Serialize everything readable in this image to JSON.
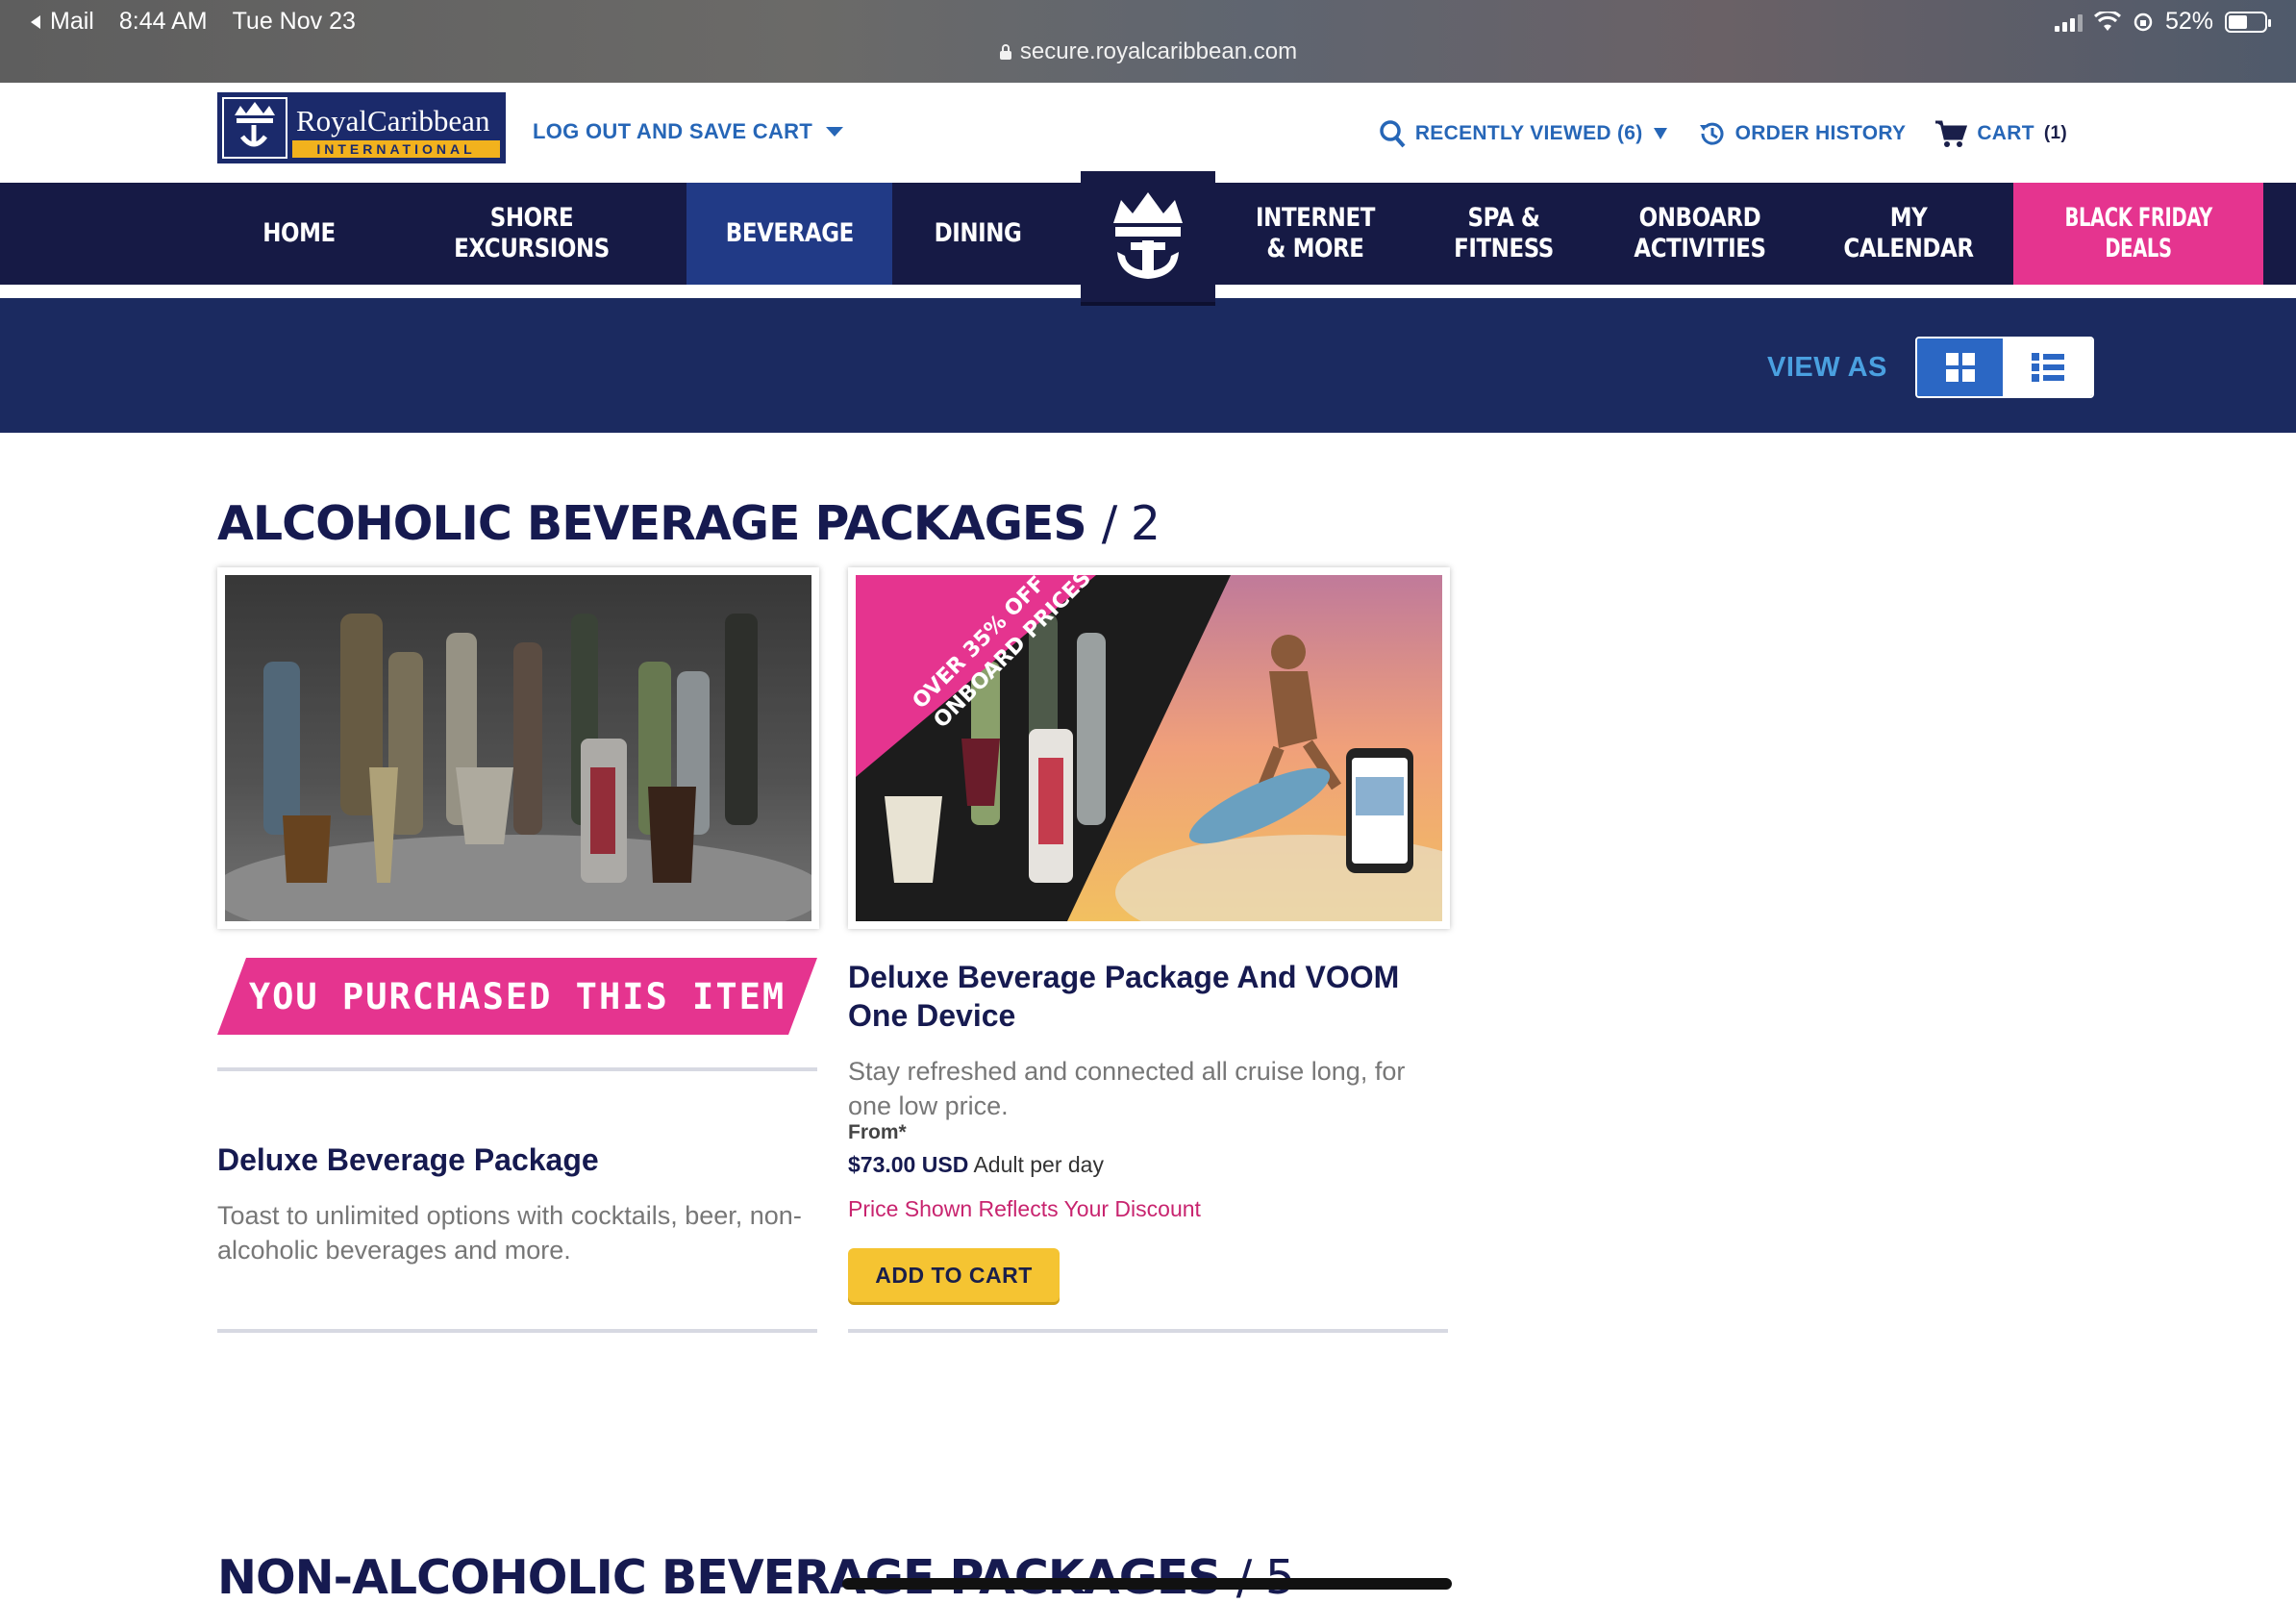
{
  "status_bar": {
    "back_app": "Mail",
    "time": "8:44 AM",
    "date": "Tue Nov 23",
    "battery": "52%",
    "battery_level": 0.52,
    "url": "secure.royalcaribbean.com"
  },
  "header": {
    "logo_text": "RoyalCaribbean",
    "logo_sub": "INTERNATIONAL",
    "logout_label": "LOG OUT AND SAVE CART",
    "recently_viewed": "RECENTLY VIEWED (6)",
    "order_history": "ORDER HISTORY",
    "cart_label": "CART",
    "cart_count": "(1)"
  },
  "nav": {
    "home": "HOME",
    "shore_excursions": "SHORE EXCURSIONS",
    "beverage": "BEVERAGE",
    "dining": "DINING",
    "internet_1": "INTERNET",
    "internet_2": "& MORE",
    "spa_1": "SPA &",
    "spa_2": "FITNESS",
    "onboard_1": "ONBOARD",
    "onboard_2": "ACTIVITIES",
    "calendar_1": "MY",
    "calendar_2": "CALENDAR",
    "black_friday_1": "BLACK FRIDAY",
    "black_friday_2": "DEALS",
    "active": "BEVERAGE"
  },
  "view_as": {
    "label": "VIEW AS",
    "selected": "grid"
  },
  "alcoholic": {
    "title": "ALCOHOLIC BEVERAGE PACKAGES",
    "count": "/ 2",
    "cards": [
      {
        "badge": "YOU PURCHASED THIS ITEM",
        "title": "Deluxe Beverage Package",
        "description": "Toast to unlimited options with cocktails, beer, non-alcoholic beverages and more."
      },
      {
        "ribbon_line1": "OVER 35% OFF",
        "ribbon_line2": "ONBOARD PRICES",
        "title": "Deluxe Beverage Package And VOOM One Device",
        "description": "Stay refreshed and connected all cruise long, for one low price.",
        "from_label": "From*",
        "price": "$73.00 USD",
        "price_unit": "Adult per day",
        "discount_note": "Price Shown Reflects Your Discount",
        "button": "ADD TO CART"
      }
    ]
  },
  "non_alcoholic": {
    "title": "NON-ALCOHOLIC BEVERAGE PACKAGES",
    "count": "/ 5"
  },
  "colors": {
    "navy": "#161a45",
    "active_nav": "#213a86",
    "pink": "#e5348f",
    "link_blue": "#2666b7",
    "button_yellow": "#f5c432"
  }
}
